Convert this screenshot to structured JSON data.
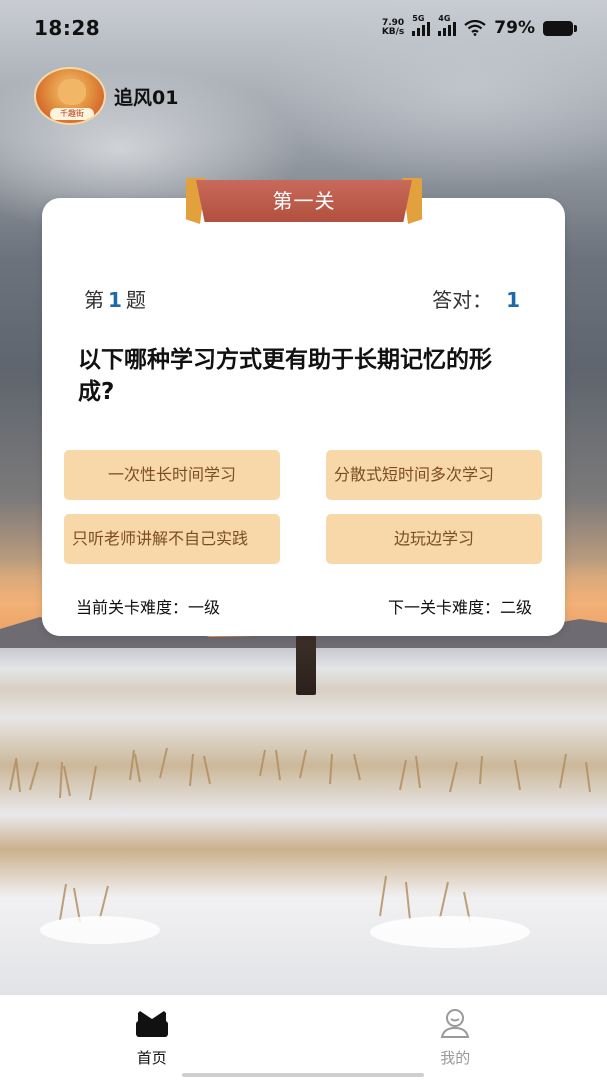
{
  "status_bar": {
    "time": "18:28",
    "net_speed_value": "7.90",
    "net_speed_unit": "KB/s",
    "signal_1_label": "5G",
    "signal_2_label": "4G",
    "battery_percent": "79%",
    "icons": [
      "signal-5g-icon",
      "signal-4g-icon",
      "wifi-icon",
      "battery-icon"
    ]
  },
  "user": {
    "name": "追风01",
    "avatar_tag": "千趣街"
  },
  "quiz": {
    "level_title": "第一关",
    "question_prefix": "第",
    "question_number": "1",
    "question_suffix": "题",
    "correct_label": "答对：",
    "correct_count": "1",
    "question_text": "以下哪种学习方式更有助于长期记忆的形成?",
    "options": [
      "一次性长时间学习",
      "分散式短时间多次学习",
      "只听老师讲解不自己实践",
      "边玩边学习"
    ],
    "current_difficulty": "当前关卡难度：一级",
    "next_difficulty": "下一关卡难度：二级",
    "colors": {
      "option_bg": "#f8d8a8",
      "option_text": "#7a4e22",
      "banner": "#b2503f",
      "number_accent": "#1e6aa8"
    }
  },
  "tab_bar": {
    "tabs": [
      {
        "label": "首页",
        "icon": "home-icon",
        "active": true
      },
      {
        "label": "我的",
        "icon": "profile-icon",
        "active": false
      }
    ]
  }
}
